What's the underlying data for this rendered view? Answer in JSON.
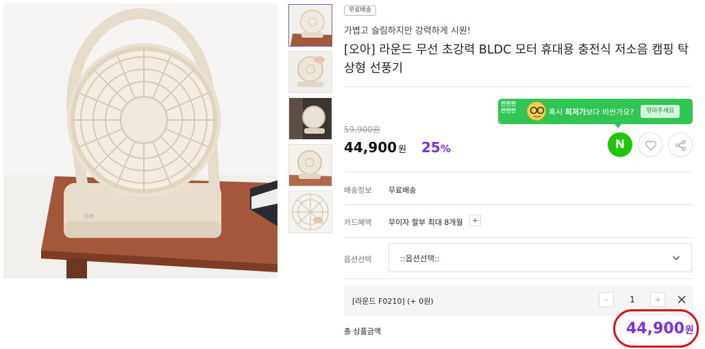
{
  "gallery": {
    "main_image_alt": "cream round desk fan",
    "thumbnails": [
      {
        "alt": "fan front view",
        "active": true
      },
      {
        "alt": "fan held in hand",
        "active": false
      },
      {
        "alt": "fan in dark room",
        "active": false
      },
      {
        "alt": "fan side view",
        "active": false
      },
      {
        "alt": "fan guard detail",
        "active": false
      }
    ]
  },
  "product": {
    "badge": "무료배송",
    "subtitle": "가볍고 슬림하지만 강력하게 시원!",
    "title": "[오아] 라운드 무선 초강력 BLDC 모터 휴대용 충전식 저소음 캠핑 탁상형 선풍기"
  },
  "promo_banner": {
    "logo_text": "짠짠짠",
    "text_prefix": "혹시 ",
    "text_bold": "최저가",
    "text_suffix": "보다 비싼가요?",
    "button_label": "깎아주세요"
  },
  "price": {
    "original": "59,900원",
    "current": "44,900",
    "currency": "원",
    "discount": "25",
    "discount_unit": "%"
  },
  "actions": {
    "naver_label": "N",
    "like_icon": "heart-icon",
    "share_icon": "share-icon"
  },
  "details": {
    "shipping_label": "배송정보",
    "shipping_value": "무료배송",
    "card_label": "카드혜택",
    "card_value": "무이자 할부 최대 8개월",
    "card_more": "+",
    "option_label": "옵션선택",
    "option_placeholder": "::옵션선택::"
  },
  "selected_option": {
    "name": "[라운드 F0210] (+ 0원)",
    "quantity": "1",
    "minus": "-",
    "plus": "+"
  },
  "total": {
    "label": "총 상품금액",
    "value": "44,900",
    "currency": "원",
    "highlight_color": "#e10d0d"
  },
  "colors": {
    "accent": "#7e2ee6",
    "naver_green": "#1ec800",
    "banner_green": "#2fc653"
  }
}
